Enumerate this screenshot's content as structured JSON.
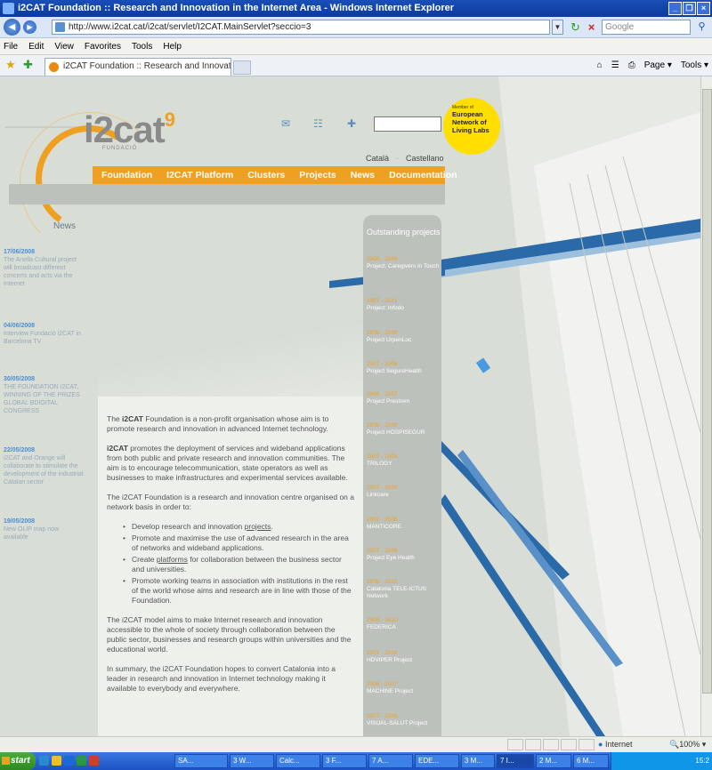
{
  "browser": {
    "window_title": "i2CAT Foundation :: Research and Innovation in the Internet Area - Windows Internet Explorer",
    "window_controls": [
      "_",
      "❐",
      "×"
    ],
    "url": "http://www.i2cat.cat/i2cat/servlet/I2CAT.MainServlet?seccio=3",
    "search_placeholder": "Google",
    "menu": [
      "File",
      "Edit",
      "View",
      "Favorites",
      "Tools",
      "Help"
    ],
    "tab_title": "i2CAT Foundation :: Research and Innovation in the I...",
    "commands": [
      "Page ▾",
      "Tools ▾"
    ],
    "status_zone": "Internet",
    "zoom": "100%"
  },
  "site": {
    "logo": "i2cat",
    "logo_mark": "9",
    "logo_sub": "FUNDACIÓ",
    "badge_small": "Member of",
    "badge_lines": [
      "European",
      "Network of",
      "Living Labs"
    ],
    "languages": [
      "Català",
      "Castellano"
    ],
    "nav": [
      "Foundation",
      "I2CAT Platform",
      "Clusters",
      "Projects",
      "News",
      "Documentation"
    ],
    "news_title": "News",
    "news": [
      {
        "date": "17/06/2008",
        "text": "The Anella Cultural project will broadcast different concerts and acts via the Internet"
      },
      {
        "date": "04/06/2008",
        "text": "Interview Fundació i2CAT in Barcelona TV"
      },
      {
        "date": "30/05/2008",
        "text": "THE FOUNDATION I2CAT, WINNING OF THE PRIZES GLOBAL BDIGITAL CONGRESS"
      },
      {
        "date": "22/05/2008",
        "text": "i2CAT and Orange will collaborate to stimulate the development of the industrial Catalan sector"
      },
      {
        "date": "19/05/2008",
        "text": "New OLIP map now available"
      }
    ],
    "content": {
      "p1_a": "The ",
      "p1_b": "i2CAT",
      "p1_c": " Foundation is a non-profit organisation whose aim is to promote research and innovation in advanced Internet technology.",
      "p2_a": "i2CAT",
      "p2_b": " promotes the deployment of services and wideband applications from both public and private research and innovation communities. The aim is to encourage telecommunication, state operators as well as businesses to make infrastructures and experimental services available.",
      "p3": "The i2CAT Foundation is a research and innovation centre organised on a network basis in order to:",
      "b1_a": "Develop research and innovation ",
      "b1_link": "projects",
      "b1_c": ".",
      "b2": "Promote and maximise the use of advanced research in the area of networks and wideband applications.",
      "b3_a": "Create ",
      "b3_link": "platforms",
      "b3_c": " for collaboration between the business sector and universities.",
      "b4": "Promote working teams in association with institutions in the rest of the world whose aims and research are in line with those of the Foundation.",
      "p4": "The i2CAT model aims to make Internet research and innovation accessible to the whole of society through collaboration between the public sector, businesses and research groups within universities and the educational world.",
      "p5": "In summary, the i2CAT Foundation hopes to convert Catalonia into a leader in research and innovation in Internet technology making it available to everybody and everywhere."
    },
    "projects_title": "Outstanding projects",
    "projects": [
      {
        "years": "2008 - 2009",
        "name": "Project: Caregivers in Touch"
      },
      {
        "years": "2007 - 2011",
        "name": "Project: Infodo"
      },
      {
        "years": "2008 - 2009",
        "name": "Project UrpenLoc"
      },
      {
        "years": "2007 - 2008",
        "name": "Project SegureHealth"
      },
      {
        "years": "2006 - 2007",
        "name": "Project Prestrem"
      },
      {
        "years": "2008 - 2009",
        "name": "Project HOSPISEGUR"
      },
      {
        "years": "2007 - 2008",
        "name": "TRILOGY"
      },
      {
        "years": "2007 - 2008",
        "name": "Linkcare"
      },
      {
        "years": "2007 - 2008",
        "name": "MANTICORE"
      },
      {
        "years": "2007 - 2008",
        "name": "Project Eye Health"
      },
      {
        "years": "2008 - 2010",
        "name": "Catalonia TELE-ICTUS Network"
      },
      {
        "years": "2008 - 2010",
        "name": "FEDERICA"
      },
      {
        "years": "2007 - 2008",
        "name": "HDVIPER Project"
      },
      {
        "years": "2006 - 2007",
        "name": "MACHINE Project"
      },
      {
        "years": "2007 - 2008",
        "name": "VISUAL-SALUT Project"
      }
    ]
  },
  "taskbar": {
    "start": "start",
    "tasks": [
      "SA...",
      "3 W...",
      "Calc...",
      "3 F...",
      "7 A...",
      "EDE...",
      "3 M...",
      "7 I...",
      "2 M...",
      "6 M..."
    ],
    "time": "15:2"
  },
  "colors": {
    "accent": "#f0a020",
    "link_blue": "#4a8fd8",
    "badge": "#ffde00",
    "panel_gray": "#bcc2bb"
  }
}
